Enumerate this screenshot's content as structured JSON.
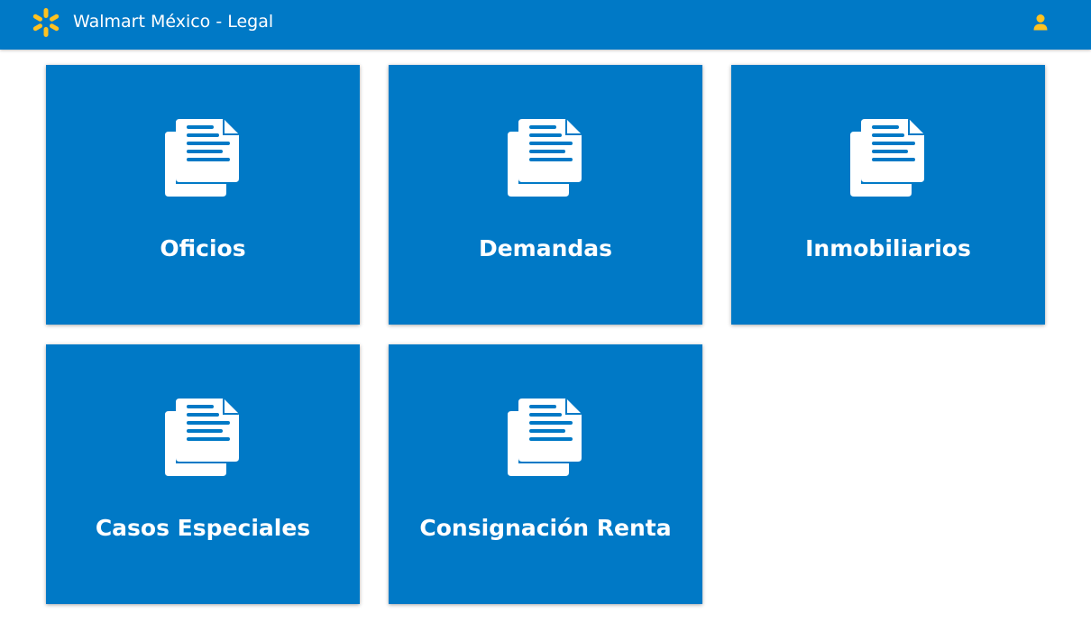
{
  "header": {
    "title": "Walmart México - Legal",
    "logo_icon": "walmart-spark-icon",
    "user_icon": "user-icon",
    "bar_color": "#0079c6",
    "accent_color": "#ffc220"
  },
  "tiles": [
    {
      "label": "Oficios",
      "icon": "document-icon"
    },
    {
      "label": "Demandas",
      "icon": "document-icon"
    },
    {
      "label": "Inmobiliarios",
      "icon": "document-icon"
    },
    {
      "label": "Casos Especiales",
      "icon": "document-icon"
    },
    {
      "label": "Consignación Renta",
      "icon": "document-icon"
    }
  ]
}
